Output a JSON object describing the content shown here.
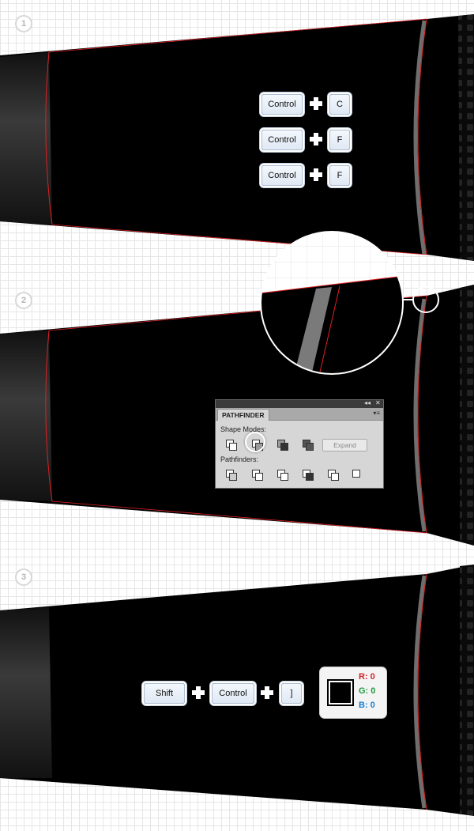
{
  "steps": [
    {
      "number": "1"
    },
    {
      "number": "2"
    },
    {
      "number": "3"
    }
  ],
  "step1": {
    "shortcuts": [
      {
        "keys": [
          "Control",
          "C"
        ]
      },
      {
        "keys": [
          "Control",
          "F"
        ]
      },
      {
        "keys": [
          "Control",
          "F"
        ]
      }
    ]
  },
  "step2": {
    "pathfinder": {
      "tab_label": "PATHFINDER",
      "collapse_glyph": "◂◂",
      "close_glyph": "✕",
      "menu_glyph": "▾≡",
      "shape_modes_label": "Shape Modes:",
      "shape_modes": [
        "unite-icon",
        "minus-front-icon",
        "intersect-icon",
        "exclude-icon"
      ],
      "expand_label": "Expand",
      "pathfinders_label": "Pathfinders:",
      "pathfinders": [
        "divide-icon",
        "trim-icon",
        "merge-icon",
        "crop-icon",
        "outline-icon",
        "minus-back-icon"
      ],
      "highlighted": "minus-front-icon"
    }
  },
  "step3": {
    "shortcut": [
      "Shift",
      "Control",
      "]"
    ],
    "fill": {
      "color": "#000000",
      "r_label": "R: 0",
      "g_label": "G: 0",
      "b_label": "B: 0"
    }
  },
  "colors": {
    "shape": "#000000",
    "path_outline": "#e02020",
    "r_color": "#d8202a",
    "g_color": "#1e9a3c",
    "b_color": "#1b7fd0"
  }
}
